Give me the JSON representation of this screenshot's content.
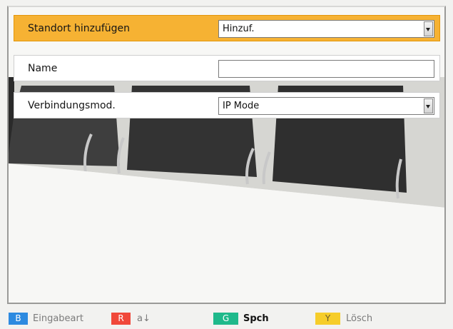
{
  "form": {
    "rows": [
      {
        "label": "Standort hinzufügen",
        "value": "Hinzuf.",
        "selected": true,
        "dropdown": true
      },
      {
        "label": "Name",
        "value": ""
      },
      {
        "label": "Verbindungsmod.",
        "value": "IP Mode",
        "dropdown": true
      }
    ]
  },
  "footer": {
    "keys": [
      {
        "key": "B",
        "label": "Eingabeart",
        "color": "#2d8ae0"
      },
      {
        "key": "R",
        "label": "a↓",
        "color": "#f0483a"
      },
      {
        "key": "G",
        "label": "Spch",
        "color": "#1fb98b"
      },
      {
        "key": "Y",
        "label": "Lösch",
        "color": "#f6cd2a"
      }
    ]
  },
  "colors": {
    "selected_row": "#f6b233",
    "row_background": "#ffffff"
  }
}
